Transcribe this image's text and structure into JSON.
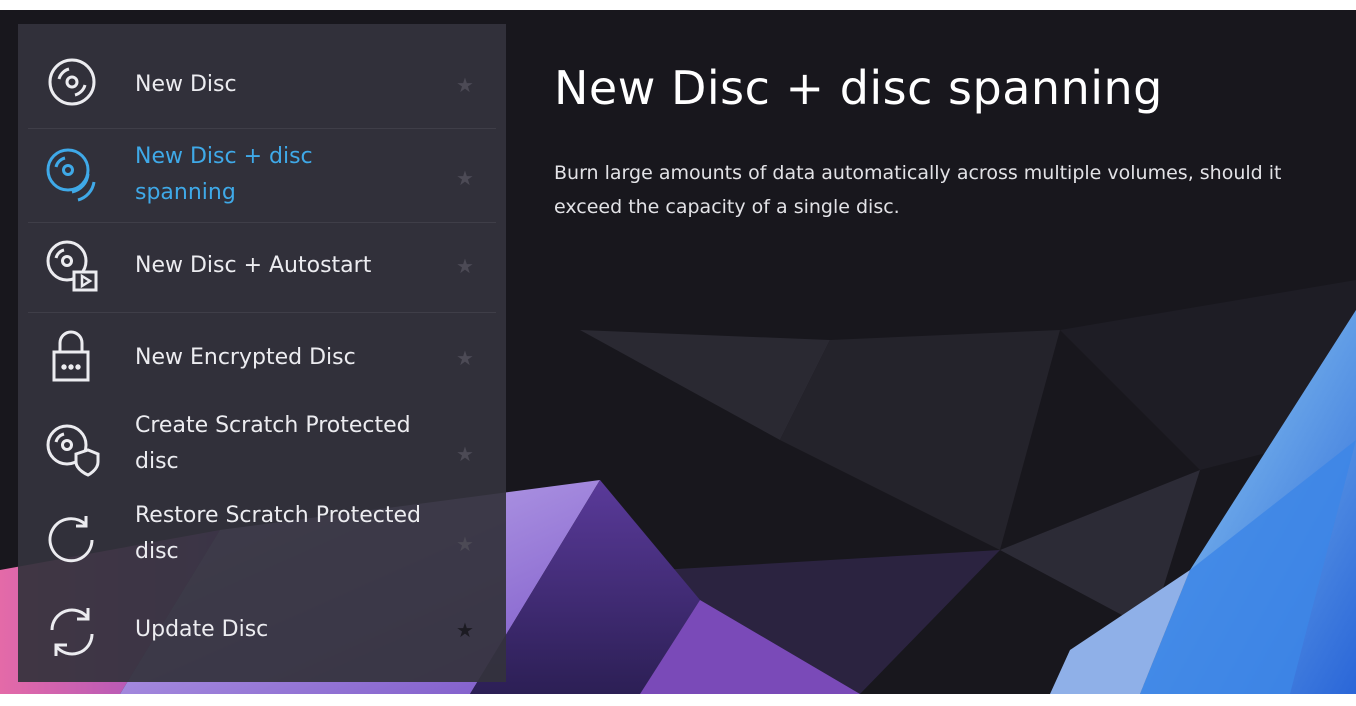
{
  "menu": {
    "items": [
      {
        "label": "New Disc",
        "icon": "disc-icon",
        "active": false,
        "favorite": false
      },
      {
        "label": "New Disc + disc spanning",
        "icon": "disc-stack-icon",
        "active": true,
        "favorite": false
      },
      {
        "label": "New Disc + Autostart",
        "icon": "disc-autostart-icon",
        "active": false,
        "favorite": false
      },
      {
        "label": "New Encrypted Disc",
        "icon": "lock-icon",
        "active": false,
        "favorite": false
      },
      {
        "label": "Create Scratch Protected disc",
        "icon": "disc-shield-icon",
        "active": false,
        "favorite": false
      },
      {
        "label": "Restore Scratch Protected disc",
        "icon": "restore-icon",
        "active": false,
        "favorite": false
      },
      {
        "label": "Update Disc",
        "icon": "refresh-icon",
        "active": false,
        "favorite": true
      }
    ]
  },
  "detail": {
    "title": "New Disc + disc spanning",
    "description": "Burn large amounts of data automatically across multiple volumes, should it exceed the capacity of a single disc."
  },
  "colors": {
    "accent": "#3fa9e8",
    "panel": "#34333c",
    "text": "#ececf0"
  }
}
